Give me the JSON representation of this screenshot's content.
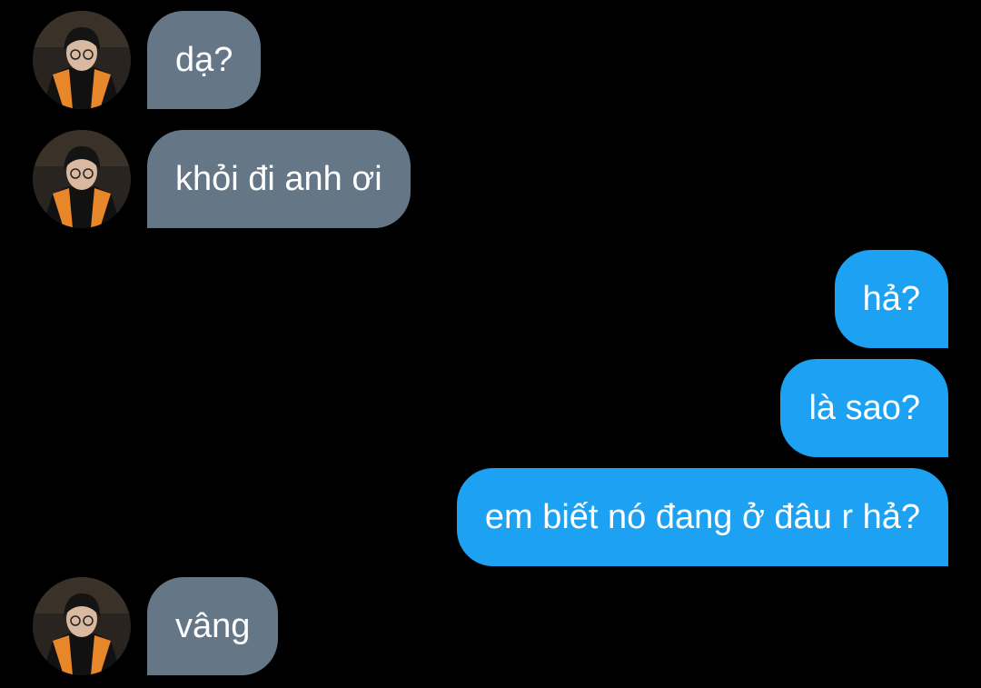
{
  "conversation": {
    "messages": [
      {
        "sender": "contact",
        "text": "dạ?"
      },
      {
        "sender": "contact",
        "text": "khỏi đi anh ơi"
      },
      {
        "sender": "me",
        "text": "hả?"
      },
      {
        "sender": "me",
        "text": "là sao?"
      },
      {
        "sender": "me",
        "text": "em biết nó đang ở đâu r hả?"
      },
      {
        "sender": "contact",
        "text": "vâng"
      }
    ]
  },
  "colors": {
    "background": "#000000",
    "incoming_bubble": "#657786",
    "outgoing_bubble": "#1da1f2",
    "text": "#ffffff"
  }
}
